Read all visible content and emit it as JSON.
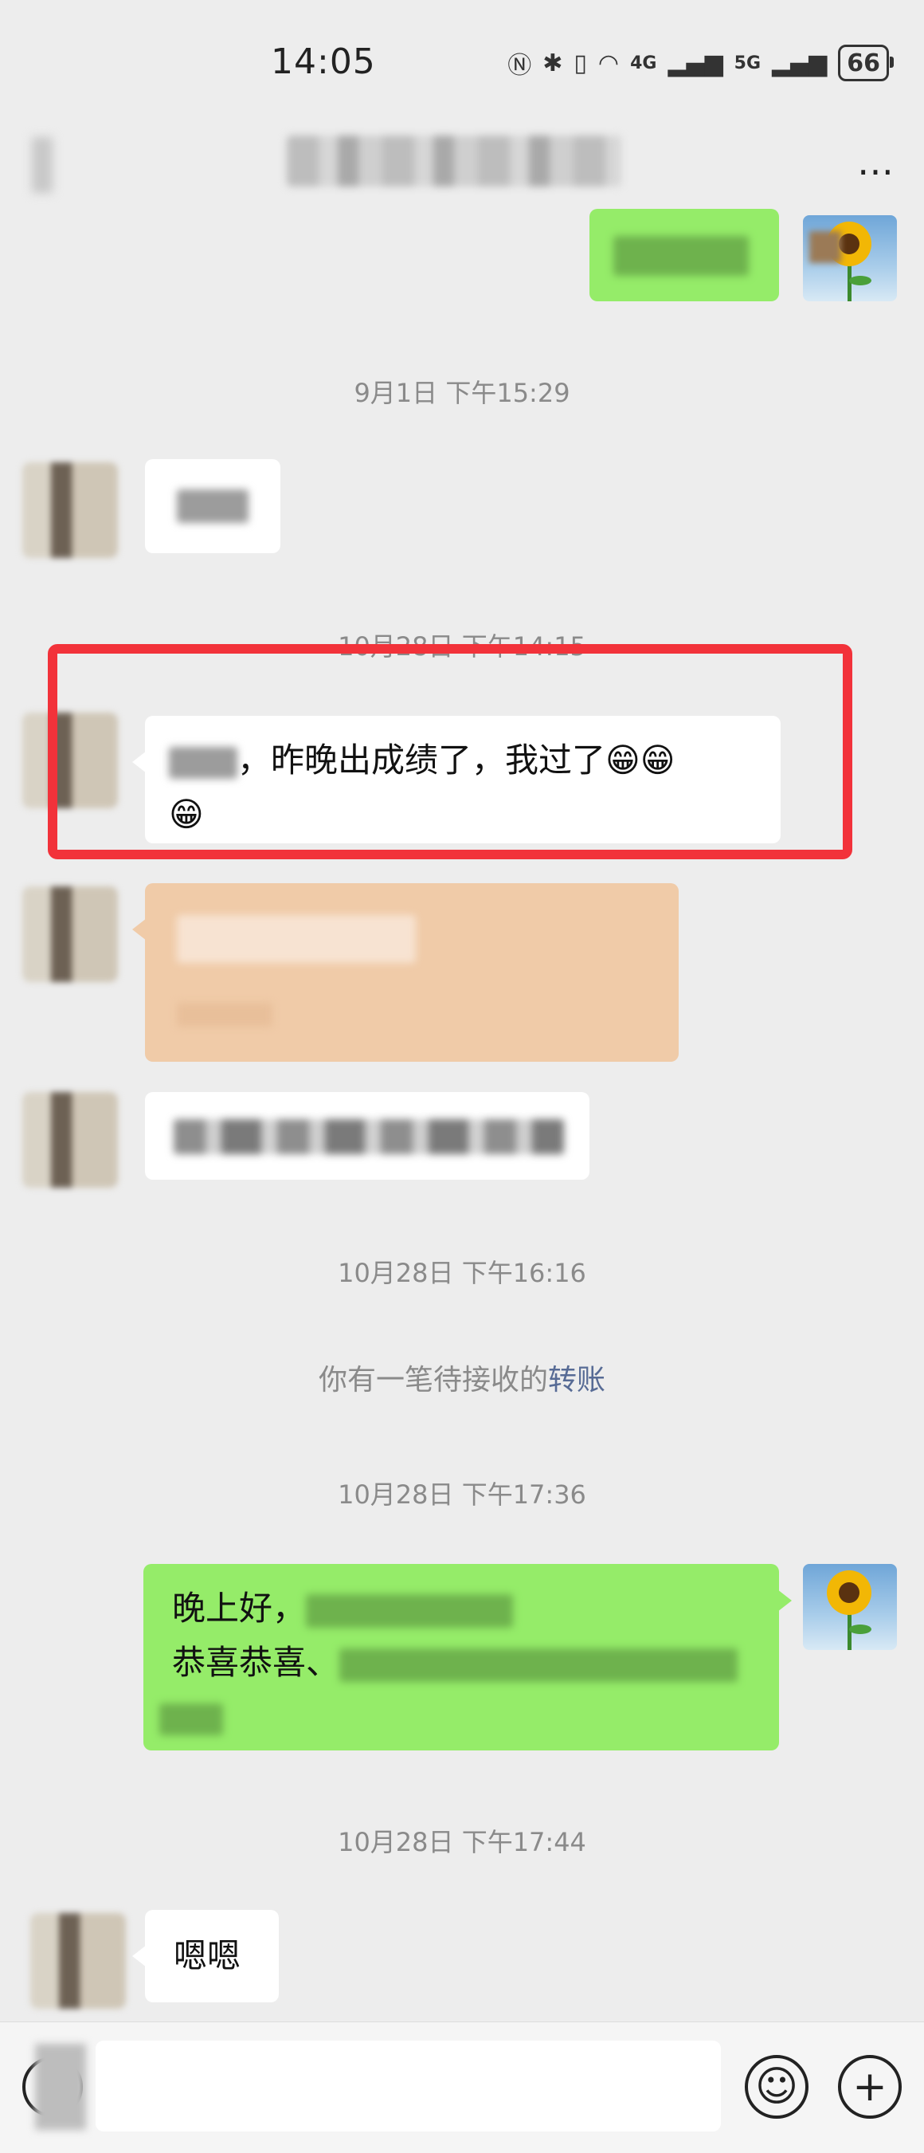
{
  "status_bar": {
    "time": "14:05",
    "icons": [
      "nfc-icon",
      "bluetooth-icon",
      "vibrate-icon",
      "wifi-icon",
      "4g-signal-icon",
      "5g-signal-icon"
    ],
    "network_labels": [
      "4G",
      "5G"
    ],
    "battery": "66"
  },
  "nav": {
    "more": "…"
  },
  "timestamps": {
    "t1": "9月1日 下午15:29",
    "t2": "10月28日 下午14:15",
    "t3": "10月28日 下午16:16",
    "t4": "10月28日 下午17:36",
    "t5": "10月28日 下午17:44"
  },
  "messages": {
    "highlight_text": "，昨晚出成绩了，我过了",
    "highlight_emoji": "😁😁",
    "highlight_emoji2": "😁",
    "green_line1": "晚上好，",
    "green_line2": "恭喜恭喜、",
    "last_reply": "嗯嗯"
  },
  "system": {
    "transfer_prefix": "你有一笔待接收的",
    "transfer_link": "转账"
  },
  "input_bar": {
    "emoji_btn": "☺",
    "plus_btn": "+"
  },
  "colors": {
    "bg": "#ededed",
    "green_bubble": "#95ec69",
    "highlight": "#f2323a",
    "link": "#576b95"
  }
}
